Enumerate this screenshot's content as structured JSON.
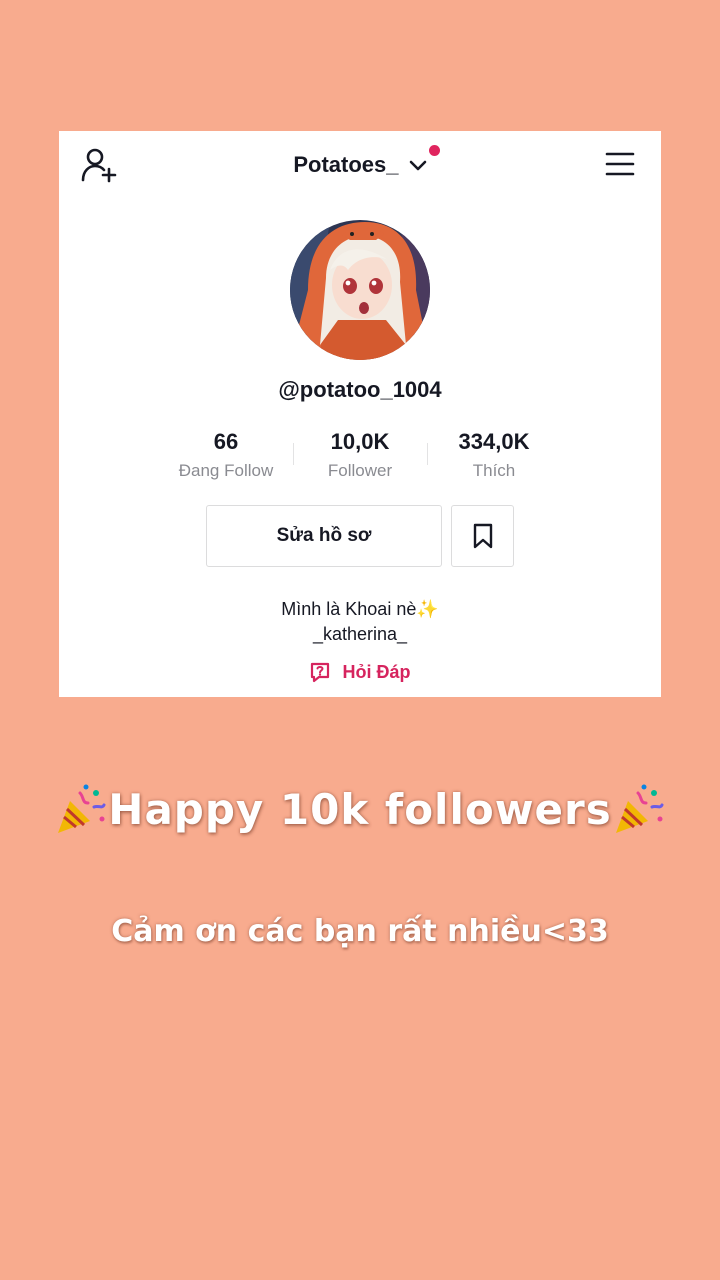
{
  "header": {
    "account_name": "Potatoes_",
    "notification_dot_color": "#e0245e"
  },
  "profile": {
    "handle": "@potatoo_1004",
    "stats": [
      {
        "value": "66",
        "label": "Đang Follow"
      },
      {
        "value": "10,0K",
        "label": "Follower"
      },
      {
        "value": "334,0K",
        "label": "Thích"
      }
    ],
    "edit_label": "Sửa hồ sơ",
    "bio_line1": "Mình là Khoai nè✨",
    "bio_line2": "_katherina_",
    "qa_label": "Hỏi Đáp"
  },
  "overlay": {
    "headline": "Happy 10k followers",
    "thanks": "Cảm ơn  các bạn rất nhiều<33"
  },
  "colors": {
    "background": "#f8ab8e",
    "accent": "#d6245e"
  }
}
